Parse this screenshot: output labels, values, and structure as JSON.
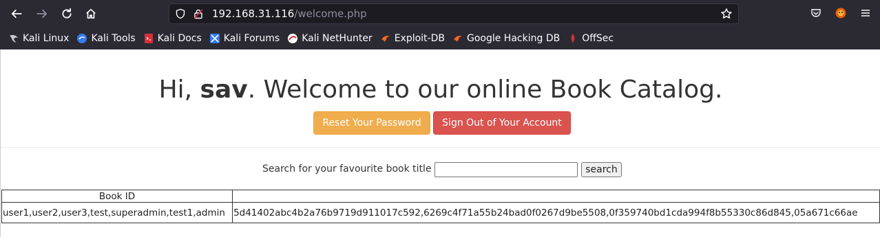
{
  "browser": {
    "url_host": "192.168.31.116",
    "url_path": "/welcome.php",
    "bookmarks": [
      {
        "label": "Kali Linux",
        "icon": "kali-dragon-icon"
      },
      {
        "label": "Kali Tools",
        "icon": "kali-tools-icon"
      },
      {
        "label": "Kali Docs",
        "icon": "kali-docs-icon"
      },
      {
        "label": "Kali Forums",
        "icon": "kali-forums-icon"
      },
      {
        "label": "Kali NetHunter",
        "icon": "nethunter-icon"
      },
      {
        "label": "Exploit-DB",
        "icon": "exploit-db-icon"
      },
      {
        "label": "Google Hacking DB",
        "icon": "ghdb-icon"
      },
      {
        "label": "OffSec",
        "icon": "offsec-icon"
      }
    ]
  },
  "page": {
    "greeting_prefix": "Hi, ",
    "username": "sav",
    "greeting_suffix": ". Welcome to our online Book Catalog.",
    "reset_button": "Reset Your Password",
    "signout_button": "Sign Out of Your Account",
    "search_label": "Search for your favourite book title",
    "search_value": "",
    "search_button": "search",
    "table": {
      "headers": [
        "Book ID",
        ""
      ],
      "rows": [
        [
          "user1,user2,user3,test,superadmin,test1,admin",
          "5d41402abc4b2a76b9719d911017c592,6269c4f71a55b24bad0f0267d9be5508,0f359740bd1cda994f8b55330c86d845,05a671c66ae"
        ]
      ]
    }
  }
}
